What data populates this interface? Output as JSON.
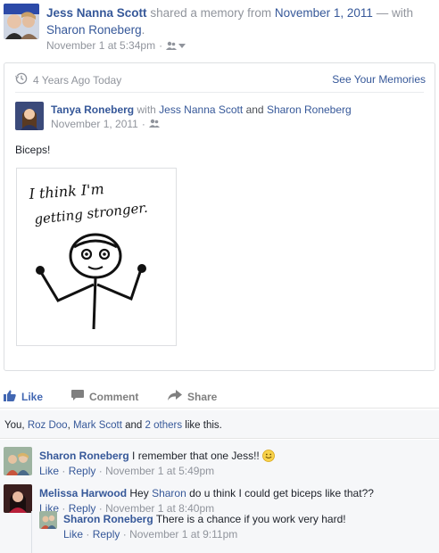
{
  "header": {
    "author": "Jess Nanna Scott",
    "action_text": "shared a memory from",
    "memory_date": "November 1, 2011",
    "dash_with": "— with",
    "tagged": "Sharon Roneberg",
    "period": ".",
    "timestamp": "November 1 at 5:34pm",
    "dot": "·"
  },
  "memory": {
    "label": "4 Years Ago Today",
    "see_memories": "See Your Memories",
    "original_author": "Tanya Roneberg",
    "with_word": "with",
    "tagged_1": "Jess Nanna Scott",
    "and_word": "and",
    "tagged_2": "Sharon Roneberg",
    "original_date": "November 1, 2011",
    "dot": "·",
    "post_text": "Biceps!",
    "drawing_caption_line1": "I think I'm",
    "drawing_caption_line2": "getting stronger."
  },
  "actions": {
    "like": "Like",
    "comment": "Comment",
    "share": "Share"
  },
  "likes": {
    "you": "You,",
    "person_1": "Roz Doo",
    "comma": ",",
    "person_2": "Mark Scott",
    "and_word": "and",
    "others": "2 others",
    "suffix": "like this."
  },
  "comments": [
    {
      "author": "Sharon Roneberg",
      "text": "I remember that one Jess!!",
      "emoji": "smile-emoji",
      "like": "Like",
      "reply": "Reply",
      "time": "November 1 at 5:49pm"
    },
    {
      "author": "Melissa Harwood",
      "text_before": "Hey",
      "mention": "Sharon",
      "text_after": "do u think I could get biceps like that??",
      "like": "Like",
      "reply": "Reply",
      "time": "November 1 at 8:40pm"
    },
    {
      "author": "Sharon Roneberg",
      "text": "There is a chance if you work very hard!",
      "like": "Like",
      "reply": "Reply",
      "time": "November 1 at 9:11pm"
    }
  ],
  "meta_dot": "·",
  "icons": {
    "audience": "friends-icon",
    "audience_dropdown": "caret-down-icon",
    "memory": "clock-history-icon",
    "like": "thumbs-up-icon",
    "comment": "speech-bubble-icon",
    "share": "share-arrow-icon"
  },
  "colors": {
    "link": "#365899",
    "like_blue": "#4267b2",
    "grey_text": "#90949c",
    "border": "#dddfe2",
    "comment_bg": "#f6f7f9"
  }
}
